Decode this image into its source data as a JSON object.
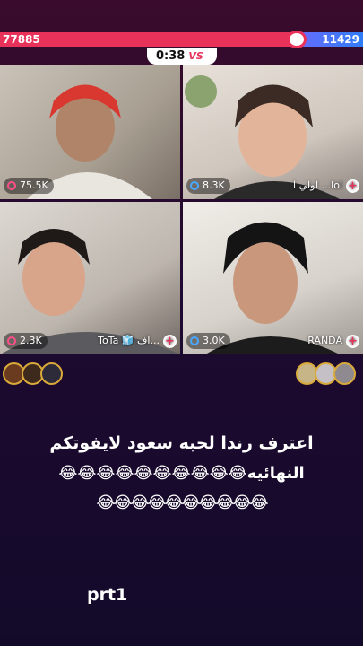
{
  "battle": {
    "score_left": "77885",
    "score_right": "11429",
    "timer": "0:38",
    "vs_label": "VS"
  },
  "tiles": [
    {
      "likes": "75.5K",
      "name": "",
      "badge_color": "#ff4f8a"
    },
    {
      "likes": "8.3K",
      "name": "لولي ا ...lol",
      "badge_color": "#49a8ff"
    },
    {
      "likes": "2.3K",
      "name": "ToTa 🧊 اف...",
      "badge_color": "#ff4f8a"
    },
    {
      "likes": "3.0K",
      "name": "RANDA",
      "badge_color": "#49a8ff"
    }
  ],
  "caption": {
    "line1": "اعترف رندا لحبه سعود لايفوتكم",
    "line2": "النهائيه😂😂😂😂😂😂😂😂😂😂",
    "line3": "😂😂😂😂😂😂😂😂😂😂"
  },
  "footer": {
    "part_label": "prt1"
  },
  "colors": {
    "red": "#e8325a",
    "blue": "#2f7cf6",
    "bg": "#1f0a30"
  }
}
